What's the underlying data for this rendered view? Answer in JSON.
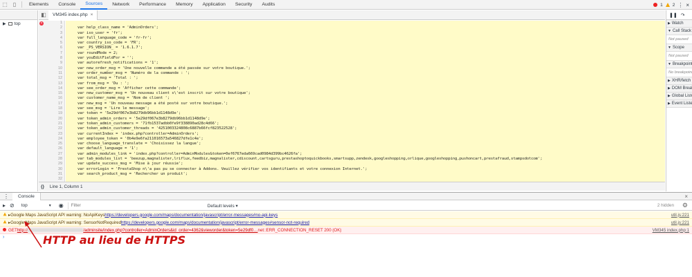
{
  "toolbar": {
    "tabs": [
      "Elements",
      "Console",
      "Sources",
      "Network",
      "Performance",
      "Memory",
      "Application",
      "Security",
      "Audits"
    ],
    "active_tab": "Sources",
    "error_count": "1",
    "warning_count": "2"
  },
  "navigator": {
    "top_label": "top"
  },
  "file_tab": {
    "name": "VM345 index.php",
    "close": "×"
  },
  "editor": {
    "line_numbers": [
      "1",
      "2",
      "3",
      "4",
      "5",
      "6",
      "7",
      "8",
      "9",
      "10",
      "11",
      "12",
      "13",
      "14",
      "15",
      "16",
      "17",
      "18",
      "19",
      "20",
      "21",
      "22",
      "23",
      "24",
      "25",
      "26",
      "27",
      "28",
      "29",
      "30",
      "31",
      "32"
    ],
    "lines": [
      "",
      "    var help_class_name = 'AdminOrders';",
      "    var iso_user = 'fr';",
      "    var full_language_code = 'fr-fr';",
      "    var country_iso_code = 'FR';",
      "    var _PS_VERSION_ = '1.6.1.7';",
      "    var roundMode = 2;",
      "    var youEditFieldFor = '';",
      "    var autorefresh_notifications = '1';",
      "    var new_order_msg = 'Une nouvelle commande a été passée sur votre boutique.';",
      "    var order_number_msg = 'Numéro de la commande : ';",
      "    var total_msg = 'Total : ';",
      "    var from_msg = 'Du : ';",
      "    var see_order_msg = 'Afficher cette commande';",
      "    var new_customer_msg = 'Un nouveau client s\\'est inscrit sur votre boutique';",
      "    var customer_name_msg = 'Nom de client ';",
      "    var new_msg = 'Un nouveau message a été posté sur votre boutique.';",
      "    var see_msg = 'Lire le message';",
      "    var token = '5e29df067e3b8279db96bb1d1148d9e';",
      "    var token_admin_orders = '5e29df067e3b8279db96bb1d1148d9e';",
      "    var token_admin_customers = '71fb1537adbb0fe9f338890ad28c4d66';",
      "    var token_admin_customer_threads = '4251003324808c6887b66fcf823522528';",
      "    var currentIndex = 'index.php?controller=AdminOrders';",
      "    var employee_token = '0b4e9e6fa211016573a546827dfe1c4e';",
      "    var choose_language_translate = 'Choisissez la langue';",
      "    var default_language = '1';",
      "    var admin_modules_link = 'index.php?controller=AdminModules&token=0ef6767eda669cad0984d399bc4626fa';",
      "    var tab_modules_list = 'beezup,magnalister,lriflux,feedbiz,magnalister,cdiscount,cartsguru,prestashoptoquickbooks,smartsupp,zendesk,googleshopping,orlique,googleshopping,pushoncart,prestafraud,stampsdotcom';",
      "    var update_success_msg = 'Mise à jour réussie';",
      "    var errorLogin = 'PrestaShop n\\'a pas pu se connecter à Addons. Veuillez vérifier vos identifiants et votre connexion Internet.';",
      "    var search_product_msg = 'Rechercher un produit';",
      ""
    ]
  },
  "statusbar": {
    "braces": "{}",
    "position": "Line 1, Column 1"
  },
  "debugger": {
    "sections": [
      {
        "label": "Watch",
        "body": ""
      },
      {
        "label": "Call Stack",
        "body": "Not paused"
      },
      {
        "label": "Scope",
        "body": "Not paused"
      },
      {
        "label": "Breakpoints",
        "body": "No breakpoints"
      },
      {
        "label": "XHR/fetch",
        "body": ""
      },
      {
        "label": "DOM Breakpoints",
        "body": ""
      },
      {
        "label": "Global Listeners",
        "body": ""
      },
      {
        "label": "Event Listener",
        "body": ""
      }
    ]
  },
  "console": {
    "drawer_tab": "Console",
    "context": "top",
    "filter_placeholder": "Filter",
    "levels": "Default levels ▾",
    "hidden": "2 hidden",
    "messages": [
      {
        "type": "warn",
        "prefix": "▸Google Maps JavaScript API warning: NoApiKeys ",
        "link": "https://developers.google.com/maps/documentation/javascript/error-messages#no-api-keys",
        "source": "util.js:221"
      },
      {
        "type": "warn",
        "prefix": "▸Google Maps JavaScript API warning: SensorNotRequired ",
        "link": "https://developers.google.com/maps/documentation/javascript/error-messages#sensor-not-required",
        "source": "util.js:221"
      },
      {
        "type": "error",
        "prefix": "GET ",
        "link_start": "http://",
        "link_end": "/adminsite/index.php?controller=AdminOrders&id_order=4362&vieworder&token=5e29df0…",
        "suffix": " net::ERR_CONNECTION_RESET 200 (OK)",
        "source": "VM345 index.php:1"
      }
    ]
  },
  "annotation": {
    "text": "HTTP au lieu de HTTPS",
    "color": "#cc1111"
  }
}
